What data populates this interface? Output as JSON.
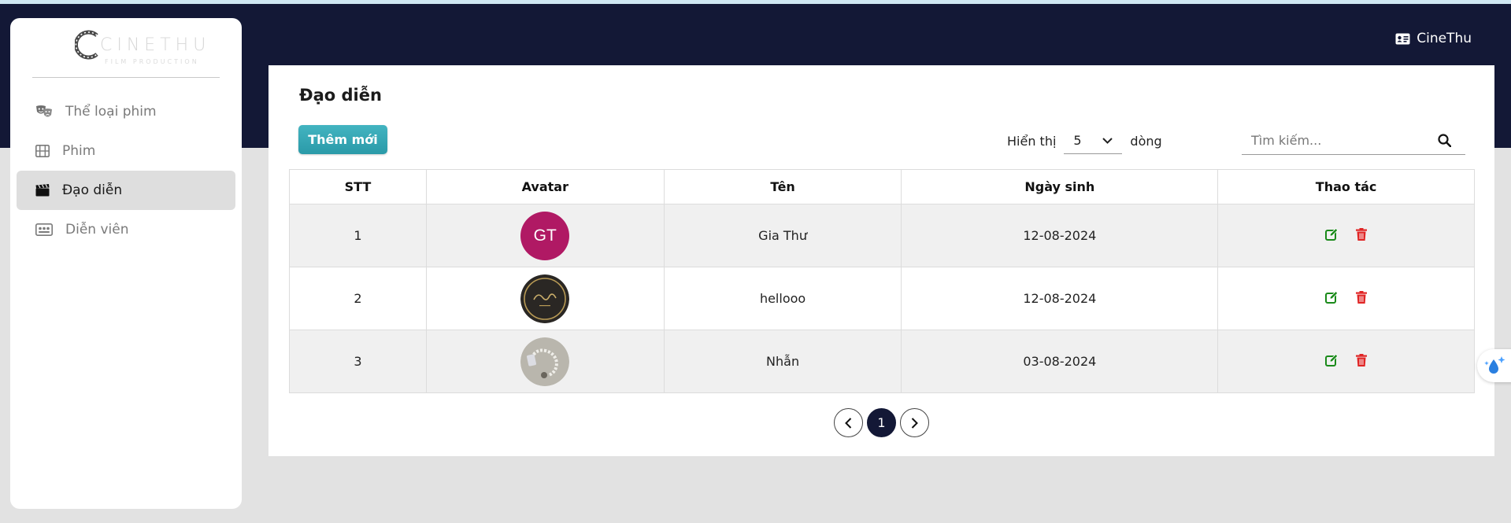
{
  "app": {
    "user_name": "CineThu"
  },
  "brand": {
    "name": "CINETHU",
    "tagline": "FILM PRODUCTION"
  },
  "sidebar": {
    "items": [
      {
        "label": "Thể loại phim",
        "icon": "theater-masks-icon",
        "active": false
      },
      {
        "label": "Phim",
        "icon": "film-icon",
        "active": false
      },
      {
        "label": "Đạo diễn",
        "icon": "clapperboard-icon",
        "active": true
      },
      {
        "label": "Diễn viên",
        "icon": "id-badge-icon",
        "active": false
      }
    ]
  },
  "main": {
    "title": "Đạo diễn",
    "add_button": "Thêm mới",
    "show_label": "Hiển thị",
    "rows_per_page": "5",
    "rows_label": "dòng",
    "search_placeholder": "Tìm kiếm..."
  },
  "table": {
    "headers": [
      "STT",
      "Avatar",
      "Tên",
      "Ngày sinh",
      "Thao tác"
    ],
    "rows": [
      {
        "stt": "1",
        "avatar_text": "GT",
        "avatar_type": "initials",
        "name": "Gia Thư",
        "dob": "12-08-2024"
      },
      {
        "stt": "2",
        "avatar_text": "",
        "avatar_type": "image-dark-logo",
        "name": "hellooo",
        "dob": "12-08-2024"
      },
      {
        "stt": "3",
        "avatar_text": "",
        "avatar_type": "image-photo",
        "name": "Nhẫn",
        "dob": "03-08-2024"
      }
    ]
  },
  "pagination": {
    "current": "1"
  },
  "colors": {
    "header_bg": "#131836",
    "accent": "#2fa5b2",
    "edit_icon": "#1a8a1a",
    "delete_icon": "#e02424",
    "avatar_initials_bg": "#b01964"
  }
}
